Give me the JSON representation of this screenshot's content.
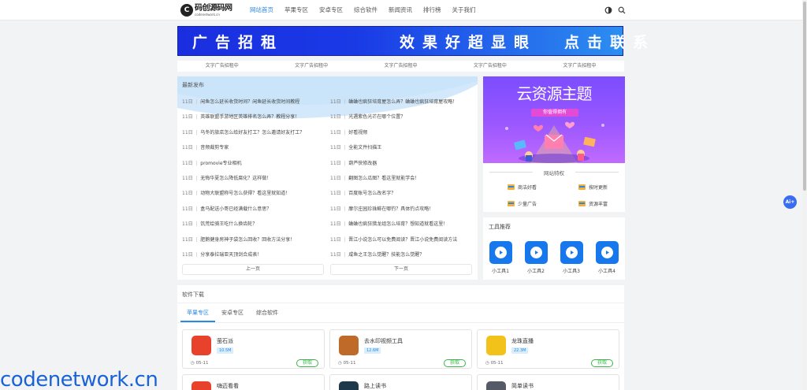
{
  "header": {
    "logo_text": "码创源码网",
    "logo_sub": "codenetwork.cn",
    "nav": [
      "网站首页",
      "苹果专区",
      "安卓专区",
      "综合软件",
      "新闻资讯",
      "排行榜",
      "关于我们"
    ]
  },
  "ad_banner": {
    "part1": "广告招租",
    "part2": "效果好超显眼",
    "part3": "点击联系"
  },
  "text_ads": [
    "文字广告招租中",
    "文字广告招租中",
    "文字广告招租中",
    "文字广告招租中",
    "文字广告招租中"
  ],
  "latest": {
    "title": "最新发布",
    "left": [
      {
        "date": "11日",
        "title": "闲鱼怎么延长收货时间？闲鱼延长收货时间教程"
      },
      {
        "date": "11日",
        "title": "英雄联盟手游地区英雄排名怎么弄？教程分享！"
      },
      {
        "date": "11日",
        "title": "乌冬的旅店怎么给好友打工？怎么邀请好友打工？"
      },
      {
        "date": "11日",
        "title": "音频裁剪专家"
      },
      {
        "date": "11日",
        "title": "promovie专业相机"
      },
      {
        "date": "11日",
        "title": "无悔华夏怎么降低腐化？这样做！"
      },
      {
        "date": "11日",
        "title": "动物大联盟称号怎么获得？看这里就知道！"
      },
      {
        "date": "11日",
        "title": "盒马配送小哥已经满载什么意思？"
      },
      {
        "date": "11日",
        "title": "饥荒绘骑王吃什么换齿轮？"
      },
      {
        "date": "11日",
        "title": "肥鹅健身房神子袋怎么回收？回收方法分享！"
      },
      {
        "date": "11日",
        "title": "分享泰拉瑞亚天顶剑合成表！"
      }
    ],
    "right": [
      {
        "date": "11日",
        "title": "蛐蛐也疯狂培育屋怎么弄？蛐蛐也疯狂培育屋攻略！"
      },
      {
        "date": "11日",
        "title": "光遇紫色光芒在哪个位置？"
      },
      {
        "date": "11日",
        "title": "好看视频"
      },
      {
        "date": "11日",
        "title": "全能文件扫描王"
      },
      {
        "date": "11日",
        "title": "葫芦侠修改器"
      },
      {
        "date": "11日",
        "title": "翻图怎么瓜图？看这里就能学会！"
      },
      {
        "date": "11日",
        "title": "百度账号怎么改名字？"
      },
      {
        "date": "11日",
        "title": "摩尔庄园珍珠鲱在哪钓？具体钓点攻略！"
      },
      {
        "date": "11日",
        "title": "蛐蛐也疯狂猎龙组怎么培育？想知道就看这里！"
      },
      {
        "date": "11日",
        "title": "晋江小说怎么可以免费阅读？晋江小说免费阅读方法"
      },
      {
        "date": "11日",
        "title": "咸鱼之王怎么觉醒？技能怎么觉醒？"
      }
    ],
    "prev": "上一页",
    "next": "下一页"
  },
  "promo": {
    "title": "云资源主题",
    "subtitle": "你值得拥有",
    "features_title": "网站特权",
    "features": [
      "商洁好看",
      "按时更新",
      "少量广告",
      "资源丰富"
    ]
  },
  "tools": {
    "title": "工具推荐",
    "items": [
      "小工具1",
      "小工具2",
      "小工具3",
      "小工具4"
    ],
    "icon_color": "#1777ec"
  },
  "software": {
    "title": "软件下载",
    "tabs": [
      "苹果专区",
      "安卓专区",
      "综合软件"
    ],
    "cards": [
      {
        "name": "萤石派",
        "size": "10.5M",
        "date": "05-11",
        "btn": "获取",
        "icon_color": "#e8412c"
      },
      {
        "name": "去水印视频工具",
        "size": "12.6M",
        "date": "05-11",
        "btn": "获取",
        "icon_color": "#c06a2a"
      },
      {
        "name": "龙珠直播",
        "size": "22.3M",
        "date": "05-11",
        "btn": "获取",
        "icon_color": "#f2c21b"
      }
    ],
    "cards_row2": [
      {
        "name": "嗨迈看看",
        "icon_color": "#e8412c"
      },
      {
        "name": "路上读书",
        "icon_color": "#1e3a4a"
      },
      {
        "name": "简单读书",
        "icon_color": "#555a66"
      }
    ]
  },
  "ai_badge": "Ai+",
  "watermark": "codenetwork.cn",
  "accent": "#2a88e6"
}
